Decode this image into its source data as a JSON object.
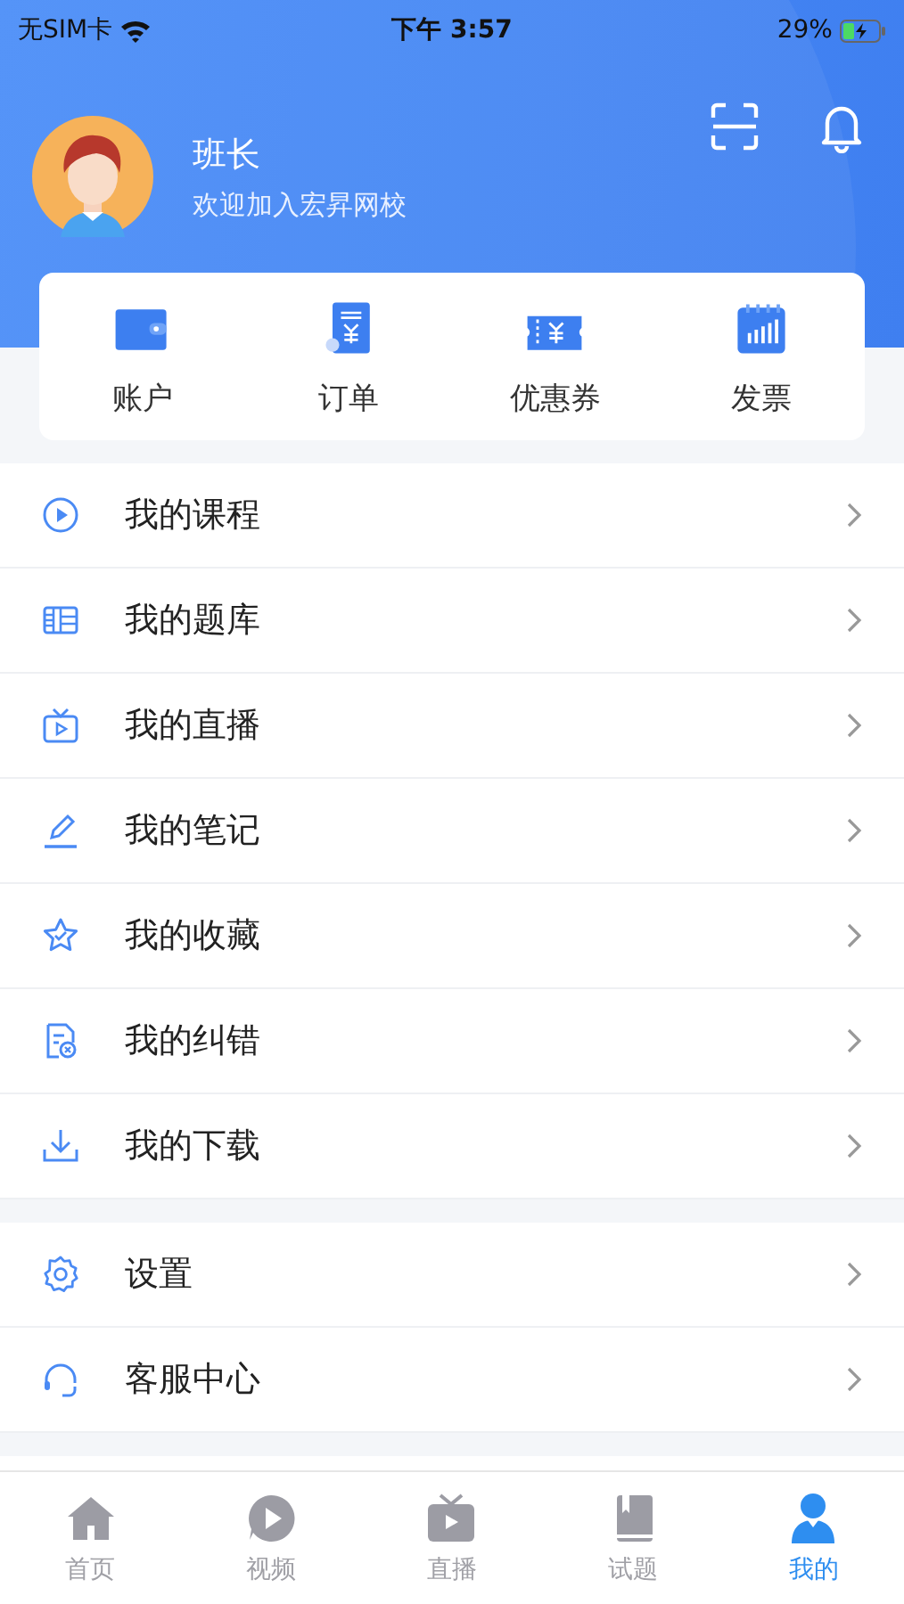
{
  "status_bar": {
    "carrier": "无SIM卡",
    "time": "下午 3:57",
    "battery": "29%"
  },
  "profile": {
    "name": "班长",
    "subtitle": "欢迎加入宏昇网校"
  },
  "shortcuts": [
    {
      "label": "账户",
      "kind": "wallet"
    },
    {
      "label": "订单",
      "kind": "order"
    },
    {
      "label": "优惠券",
      "kind": "coupon"
    },
    {
      "label": "发票",
      "kind": "invoice"
    }
  ],
  "menu_groups": [
    [
      {
        "label": "我的课程",
        "kind": "play"
      },
      {
        "label": "我的题库",
        "kind": "bank"
      },
      {
        "label": "我的直播",
        "kind": "tv"
      },
      {
        "label": "我的笔记",
        "kind": "pen"
      },
      {
        "label": "我的收藏",
        "kind": "star"
      },
      {
        "label": "我的纠错",
        "kind": "doc"
      },
      {
        "label": "我的下载",
        "kind": "download"
      }
    ],
    [
      {
        "label": "设置",
        "kind": "gear"
      },
      {
        "label": "客服中心",
        "kind": "headset"
      }
    ]
  ],
  "tabs": [
    {
      "label": "首页",
      "kind": "home",
      "selected": false
    },
    {
      "label": "视频",
      "kind": "video",
      "selected": false
    },
    {
      "label": "直播",
      "kind": "tv",
      "selected": false
    },
    {
      "label": "试题",
      "kind": "book",
      "selected": false
    },
    {
      "label": "我的",
      "kind": "me",
      "selected": true
    }
  ]
}
